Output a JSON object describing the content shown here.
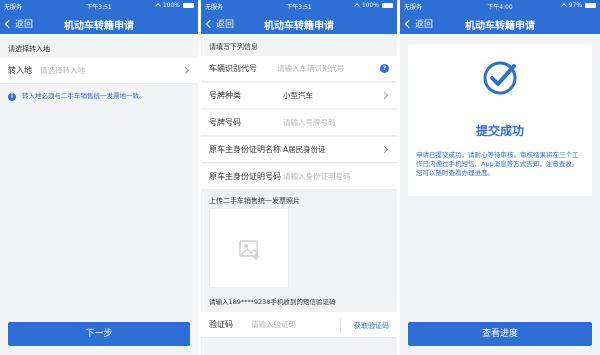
{
  "accent_color": "#2e6fd6",
  "screens": [
    {
      "status": {
        "carrier": "无服务",
        "time": "下午3:51",
        "battery": "100%",
        "battery_level": 1.0
      },
      "nav": {
        "back": "返回",
        "title": "机动车转籍申请"
      },
      "section": "请选择转入地",
      "field": {
        "label": "转入地",
        "placeholder": "请选择转入地"
      },
      "info": "转入地必须与二手车销售统一发票地一致。",
      "button": "下一步"
    },
    {
      "status": {
        "carrier": "无服务",
        "time": "下午3:51",
        "battery": "100%",
        "battery_level": 1.0
      },
      "nav": {
        "back": "返回",
        "title": "机动车转籍申请"
      },
      "section": "请填写下列信息",
      "rows": [
        {
          "label": "车辆识别代号",
          "placeholder": "请输入车辆识别代号"
        },
        {
          "label": "号牌种类",
          "value": "小型汽车"
        },
        {
          "label": "号牌号码",
          "placeholder": "请输入号牌号码"
        },
        {
          "label": "原车主身份证明名称",
          "value": "A居民身份证"
        },
        {
          "label": "原车主身份证明号码",
          "placeholder": "请输入身份证明号码"
        }
      ],
      "upload_label": "上传二手车销售统一发票照片",
      "sms_label": "请输入189****9238手机收到的短信验证码",
      "code": {
        "label": "验证码",
        "placeholder": "请输入验证码",
        "action": "获取验证码"
      }
    },
    {
      "status": {
        "carrier": "无服务",
        "time": "下午4:00",
        "battery": "97%",
        "battery_level": 0.97
      },
      "nav": {
        "back": "返回",
        "title": "机动车转籍申请"
      },
      "result_title": "提交成功",
      "result_desc": "申请已提交成功，请耐心等待审核。审核结果将在三个工作日内通过手机短信、App消息等方式告知，注意查收。您可以随时查看办理进度。",
      "button": "查看进度"
    }
  ]
}
